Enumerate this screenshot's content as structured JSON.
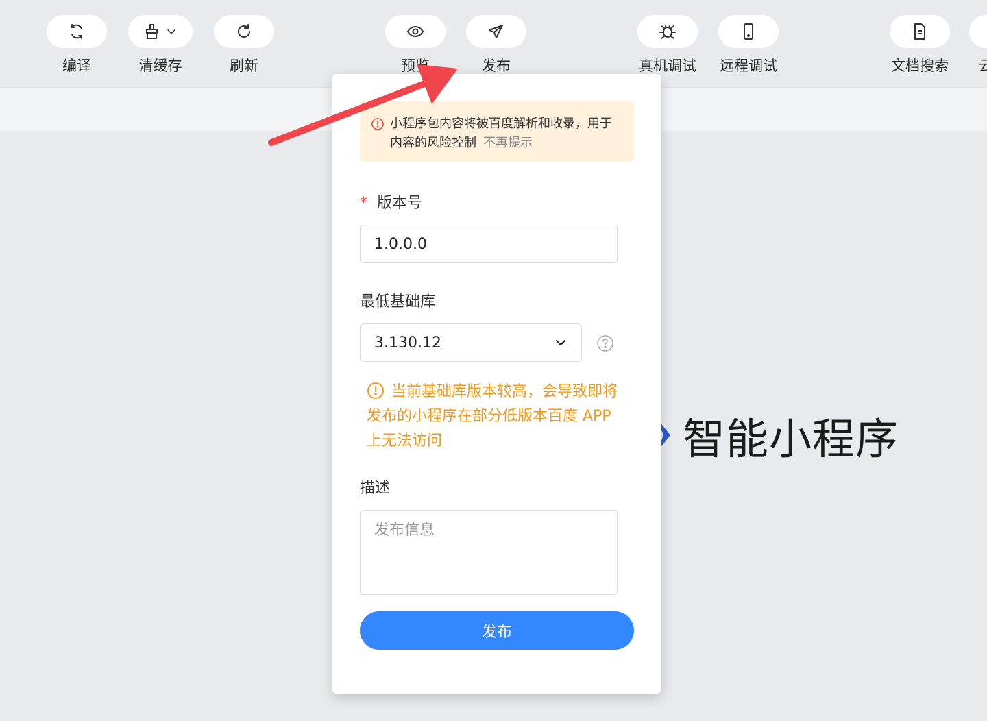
{
  "toolbar": {
    "items": [
      {
        "label": "编译",
        "icon": "compile-icon"
      },
      {
        "label": "清缓存",
        "icon": "clear-cache-icon"
      },
      {
        "label": "刷新",
        "icon": "refresh-icon"
      },
      {
        "label": "预览",
        "icon": "preview-eye-icon"
      },
      {
        "label": "发布",
        "icon": "publish-send-icon"
      },
      {
        "label": "真机调试",
        "icon": "bug-icon"
      },
      {
        "label": "远程调试",
        "icon": "phone-icon"
      },
      {
        "label": "文档搜索",
        "icon": "document-icon"
      },
      {
        "label": "云",
        "icon": "cloud-icon"
      }
    ]
  },
  "brand": {
    "text": "智能小程序",
    "color": "#2a5bd7"
  },
  "dialog": {
    "notice": {
      "text": "小程序包内容将被百度解析和收录，用于内容的风险控制",
      "dismiss": "不再提示"
    },
    "version": {
      "label": "版本号",
      "required_mark": "*",
      "value": "1.0.0.0"
    },
    "base_lib": {
      "label": "最低基础库",
      "value": "3.130.12"
    },
    "warning": "当前基础库版本较高，会导致即将发布的小程序在部分低版本百度 APP 上无法访问",
    "description": {
      "label": "描述",
      "placeholder": "发布信息"
    },
    "submit_label": "发布"
  },
  "colors": {
    "accent": "#3388ff",
    "warning": "#f29a1b",
    "notice_bg": "#fff1dc",
    "required": "#e8483f",
    "annotation_arrow": "#f0454a"
  }
}
